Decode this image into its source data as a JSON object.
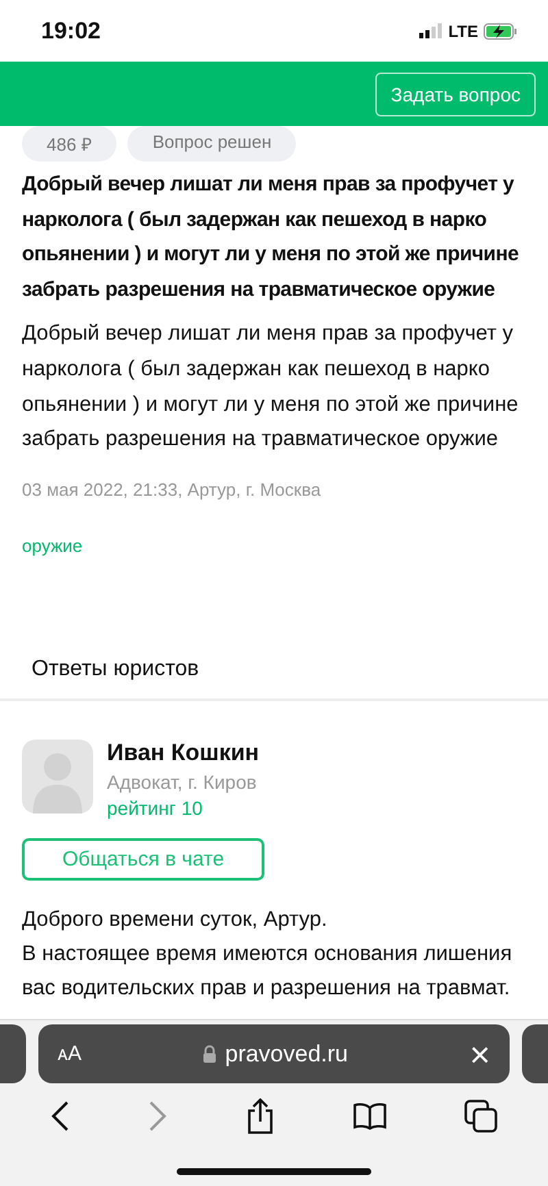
{
  "status_bar": {
    "time": "19:02",
    "network": "LTE"
  },
  "header": {
    "ask_button": "Задать вопрос"
  },
  "question": {
    "chips": [
      {
        "label": "486 ₽"
      },
      {
        "label": "Вопрос решен"
      }
    ],
    "title": "Добрый вечер лишат ли меня прав за профучет у нарколога ( был задержан как пешеход в нарко опьянении ) и могут ли у меня по этой же причине забрать разрешения на травматическое оружие",
    "body": "Добрый вечер лишат ли меня прав за профучет у нарколога ( был задержан как пешеход в нарко опьянении ) и могут ли у меня по этой же причине забрать разрешения на травматическое оружие",
    "meta": "03 мая 2022, 21:33, Артур, г. Москва",
    "tags": [
      "оружие"
    ]
  },
  "answers_heading": "Ответы юристов",
  "answers": [
    {
      "name": "Иван Кошкин",
      "role": "Адвокат, г. Киров",
      "rating": "рейтинг 10",
      "chat_button": "Общаться в чате",
      "paragraphs": [
        "Доброго времени суток, Артур.",
        "В настоящее время имеются основания лишения вас водительских прав и разрешения на травмат."
      ]
    }
  ],
  "browser": {
    "text_size": "ᴀA",
    "url": "pravoved.ru",
    "close": "×",
    "toolbar": [
      {
        "kind": "back",
        "disabled": false
      },
      {
        "kind": "forward",
        "disabled": true
      },
      {
        "kind": "share",
        "disabled": false
      },
      {
        "kind": "bookmarks",
        "disabled": false
      },
      {
        "kind": "tabs",
        "disabled": false
      }
    ]
  }
}
